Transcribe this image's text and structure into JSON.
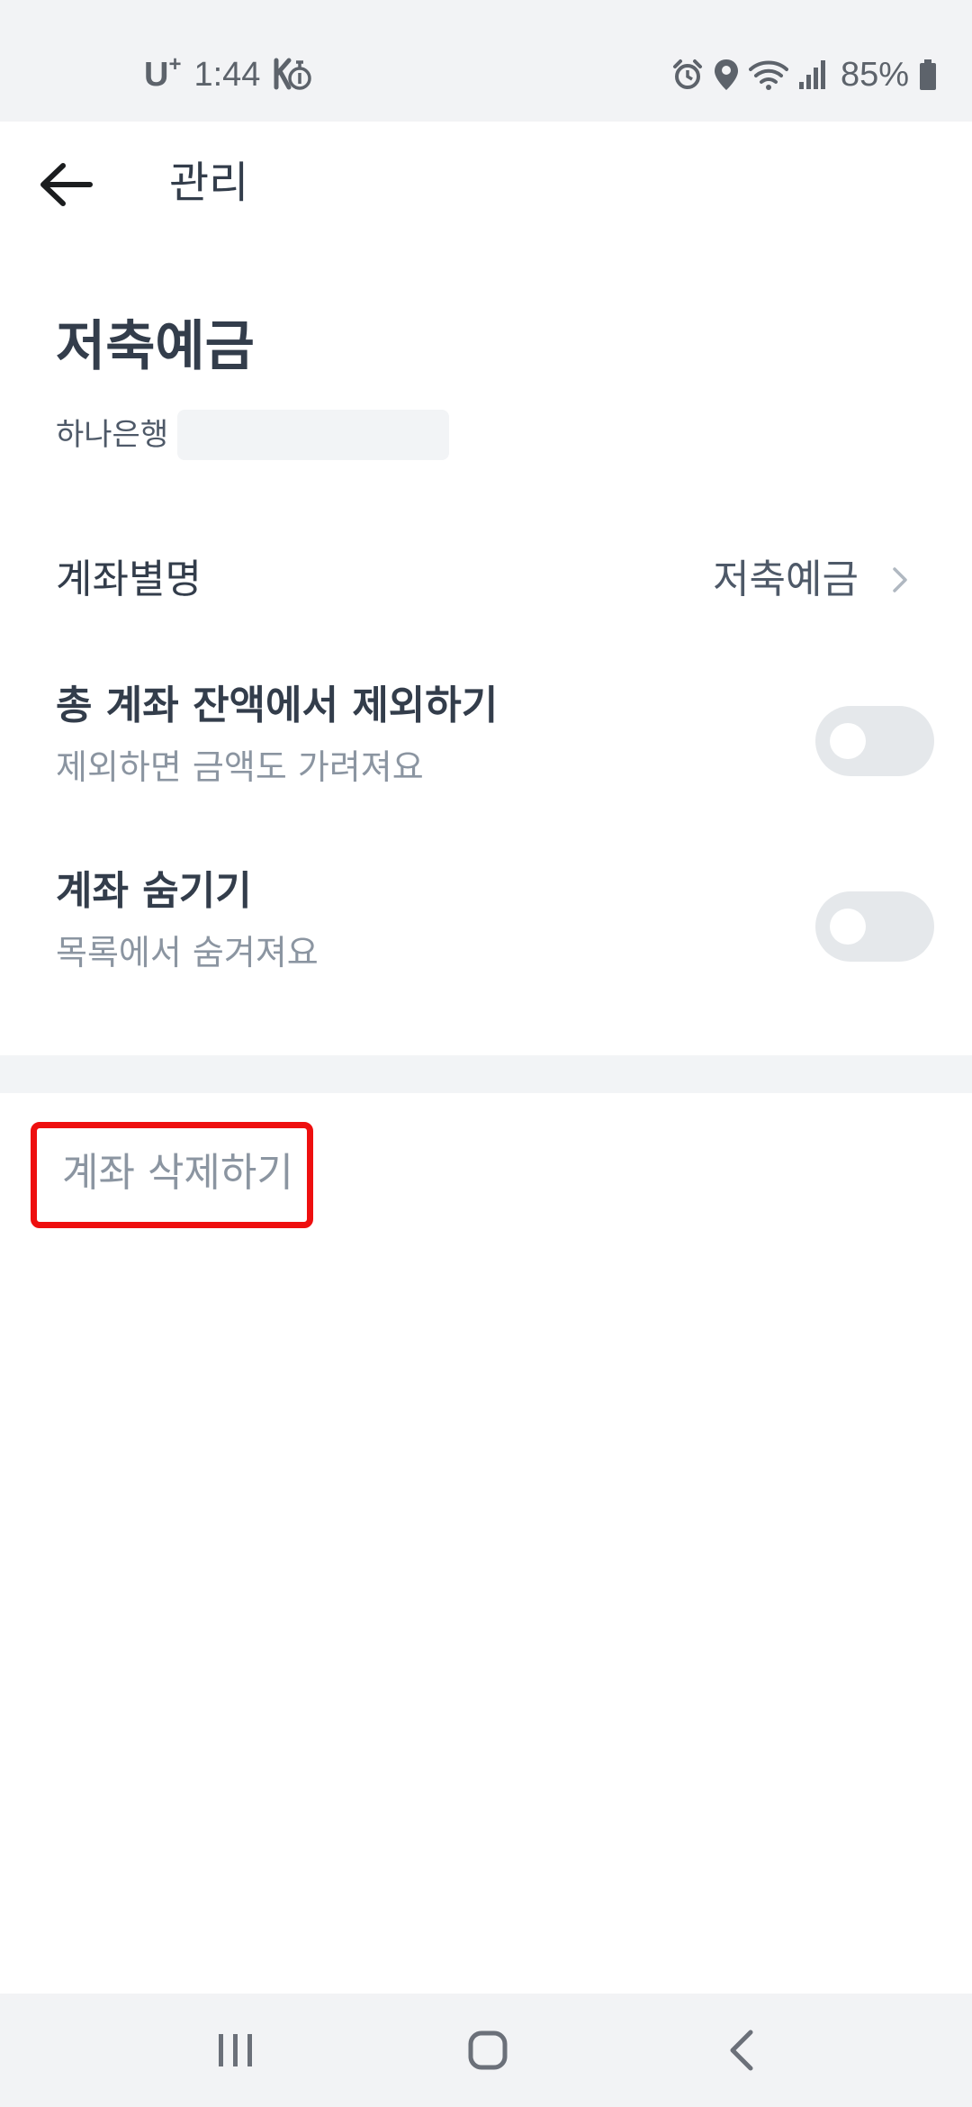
{
  "status_bar": {
    "carrier": "U",
    "carrier_sup": "+",
    "time": "1:44",
    "battery": "85%",
    "icons": [
      "kakao-talk-notification-icon",
      "alarm-icon",
      "location-icon",
      "wifi-icon",
      "signal-icon",
      "battery-icon"
    ]
  },
  "app_bar": {
    "title": "관리",
    "back_icon": "arrow-left-icon"
  },
  "account": {
    "name": "저축예금",
    "bank": "하나은행",
    "number": ""
  },
  "settings": {
    "nickname": {
      "label": "계좌별명",
      "value": "저축예금"
    },
    "exclude_balance": {
      "title": "총 계좌 잔액에서 제외하기",
      "subtitle": "제외하면 금액도 가려져요",
      "on": false
    },
    "hide_account": {
      "title": "계좌 숨기기",
      "subtitle": "목록에서 숨겨져요",
      "on": false
    }
  },
  "delete": {
    "label": "계좌 삭제하기",
    "highlight_color": "#ee0f0f"
  },
  "nav_bar": {
    "icons": [
      "recents-icon",
      "home-icon",
      "back-icon"
    ]
  },
  "colors": {
    "text_primary": "#333d4b",
    "text_secondary": "#8b95a1",
    "toggle_off": "#e5e8eb",
    "divider": "#f2f4f6"
  }
}
